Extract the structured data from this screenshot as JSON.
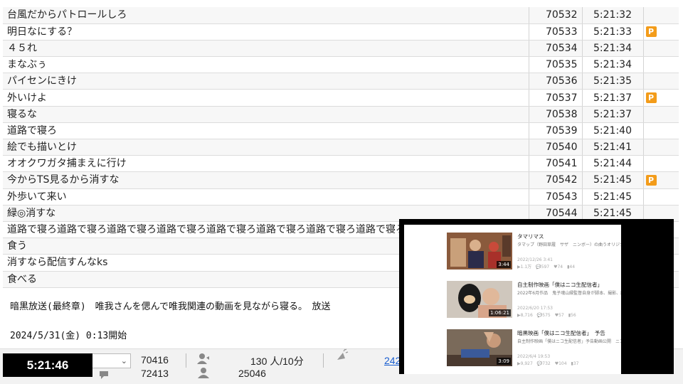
{
  "comments": [
    {
      "text": "台風だからパトロールしろ",
      "no": "70532",
      "time": "5:21:32",
      "premium": false
    },
    {
      "text": "明日なにする？",
      "no": "70533",
      "time": "5:21:33",
      "premium": true
    },
    {
      "text": "４５れ",
      "no": "70534",
      "time": "5:21:34",
      "premium": false
    },
    {
      "text": "まなぶぅ",
      "no": "70535",
      "time": "5:21:34",
      "premium": false
    },
    {
      "text": "パイセンにきけ",
      "no": "70536",
      "time": "5:21:35",
      "premium": false
    },
    {
      "text": "外いけよ",
      "no": "70537",
      "time": "5:21:37",
      "premium": true
    },
    {
      "text": "寝るな",
      "no": "70538",
      "time": "5:21:37",
      "premium": false
    },
    {
      "text": "道路で寝ろ",
      "no": "70539",
      "time": "5:21:40",
      "premium": false
    },
    {
      "text": "絵でも描いとけ",
      "no": "70540",
      "time": "5:21:41",
      "premium": false
    },
    {
      "text": "オオクワガタ捕まえに行け",
      "no": "70541",
      "time": "5:21:44",
      "premium": false
    },
    {
      "text": "今からTS見るから消すな",
      "no": "70542",
      "time": "5:21:45",
      "premium": true
    },
    {
      "text": "外歩いて来い",
      "no": "70543",
      "time": "5:21:45",
      "premium": false
    },
    {
      "text": "緑◎消すな",
      "no": "70544",
      "time": "5:21:45",
      "premium": false
    },
    {
      "text": "道路で寝ろ道路で寝ろ道路で寝ろ道路で寝ろ道路で寝ろ道路で寝ろ道路で寝ろ道路で寝ろ道路で寝ろ道",
      "no": "",
      "time": "",
      "premium": false
    },
    {
      "text": "食う",
      "no": "",
      "time": "",
      "premium": false
    },
    {
      "text": "消すなら配信すんなks",
      "no": "",
      "time": "",
      "premium": false
    },
    {
      "text": "食べる",
      "no": "",
      "time": "",
      "premium": false
    }
  ],
  "premium_badge": "P",
  "stream": {
    "title": "暗黒放送(最終章)　唯我さんを偲んで唯我関連の動画を見ながら寝る。　放送",
    "start": "2024/5/31(金) 0:13開始"
  },
  "bottom_bar": {
    "clock": "5:21:46",
    "select_icon": "chevron-down-icon",
    "stat_top": "70416",
    "stat_bottom": "72413",
    "viewers_rate": "130 人/10分",
    "viewers_total": "25046",
    "link_text": "242"
  },
  "overlay_videos": [
    {
      "title": "タマリマス",
      "desc": "タマップ（野田草履　サザ　ニンボー）の曲うオリジナル",
      "date": "2022/12/26 3:41",
      "stats": "▶1.1万　💬597　♥74　▮44",
      "duration": "3:44"
    },
    {
      "title": "自主制作映画「僕はニコ生配信者」",
      "desc": "2022年6月作品　鬼子魂山縁監督自身が脚本、撮影、編集",
      "date": "2022/6/20 17:53",
      "stats": "▶8,716　💬575　♥57　▮56",
      "duration": "1:06:21"
    },
    {
      "title": "暗黒映画「僕はニコ生配信者」　予告",
      "desc": "自主制作映画「僕はニコ生配信者」予告動画公開　ニコ",
      "date": "2022/6/4 19:53",
      "stats": "▶9,927　💬732　♥104　▮37",
      "duration": "3:09"
    }
  ],
  "colors": {
    "premium": "#f39c1a",
    "link": "#1a5fd0",
    "clock_bg": "#000000"
  }
}
